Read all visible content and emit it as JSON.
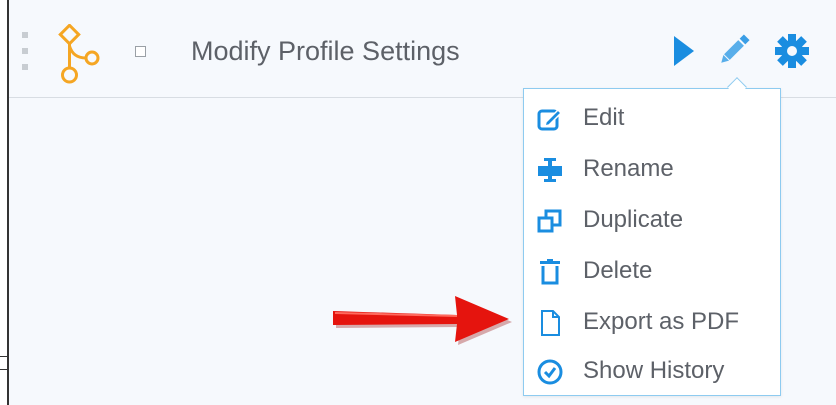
{
  "header": {
    "title": "Modify Profile Settings"
  },
  "colors": {
    "accent": "#1a8de0",
    "logo": "#f5a623",
    "arrow": "#e5140e",
    "text": "#5d6168"
  },
  "icons": {
    "logo": "workflow-branch-icon",
    "play": "play-icon",
    "edit": "pencil-icon",
    "settings": "gear-icon"
  },
  "menu": {
    "items": [
      {
        "label": "Edit",
        "icon": "edit-square-icon"
      },
      {
        "label": "Rename",
        "icon": "rename-cursor-icon"
      },
      {
        "label": "Duplicate",
        "icon": "duplicate-icon"
      },
      {
        "label": "Delete",
        "icon": "trash-icon"
      },
      {
        "label": "Export as PDF",
        "icon": "document-icon"
      },
      {
        "label": "Show History",
        "icon": "history-clock-icon"
      }
    ]
  }
}
